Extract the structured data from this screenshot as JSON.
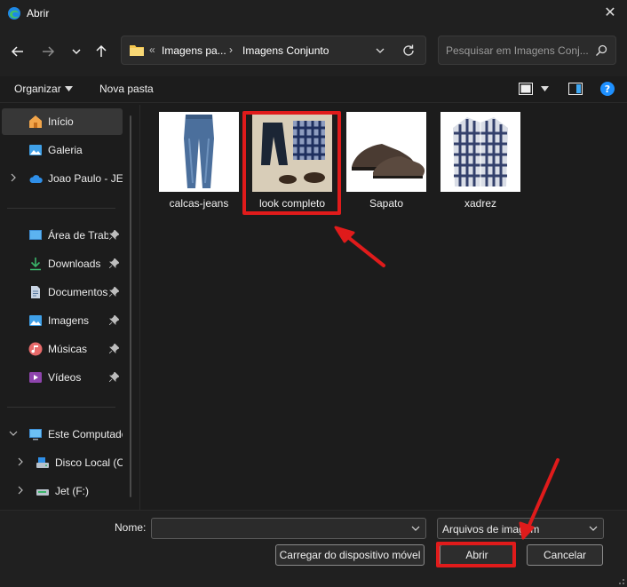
{
  "window": {
    "title": "Abrir"
  },
  "address": {
    "crumbs": [
      "Imagens pa...",
      "Imagens Conjunto"
    ]
  },
  "search": {
    "placeholder": "Pesquisar em Imagens Conj..."
  },
  "toolbar": {
    "organize_label": "Organizar",
    "new_folder_label": "Nova pasta"
  },
  "sidebar": {
    "items": [
      {
        "label": "Início",
        "icon": "home-icon"
      },
      {
        "label": "Galeria",
        "icon": "gallery-icon"
      },
      {
        "label": "Joao Paulo - JET",
        "icon": "cloud-icon"
      },
      {
        "label": "Área de Trabalho",
        "icon": "desktop-icon"
      },
      {
        "label": "Downloads",
        "icon": "download-icon"
      },
      {
        "label": "Documentos",
        "icon": "document-icon"
      },
      {
        "label": "Imagens",
        "icon": "pictures-icon"
      },
      {
        "label": "Músicas",
        "icon": "music-icon"
      },
      {
        "label": "Vídeos",
        "icon": "video-icon"
      },
      {
        "label": "Este Computador",
        "icon": "computer-icon"
      },
      {
        "label": "Disco Local (C:)",
        "icon": "drive-icon"
      },
      {
        "label": "Jet (F:)",
        "icon": "usb-drive-icon"
      }
    ]
  },
  "files": [
    {
      "name": "calcas-jeans"
    },
    {
      "name": "look completo"
    },
    {
      "name": "Sapato"
    },
    {
      "name": "xadrez"
    }
  ],
  "bottom": {
    "name_label": "Nome:",
    "name_value": "",
    "file_type": "Arquivos de imagem",
    "upload_label": "Carregar do dispositivo móvel",
    "open_label": "Abrir",
    "cancel_label": "Cancelar"
  },
  "colors": {
    "annotation": "#e01b1b",
    "accent": "#0078d4"
  }
}
